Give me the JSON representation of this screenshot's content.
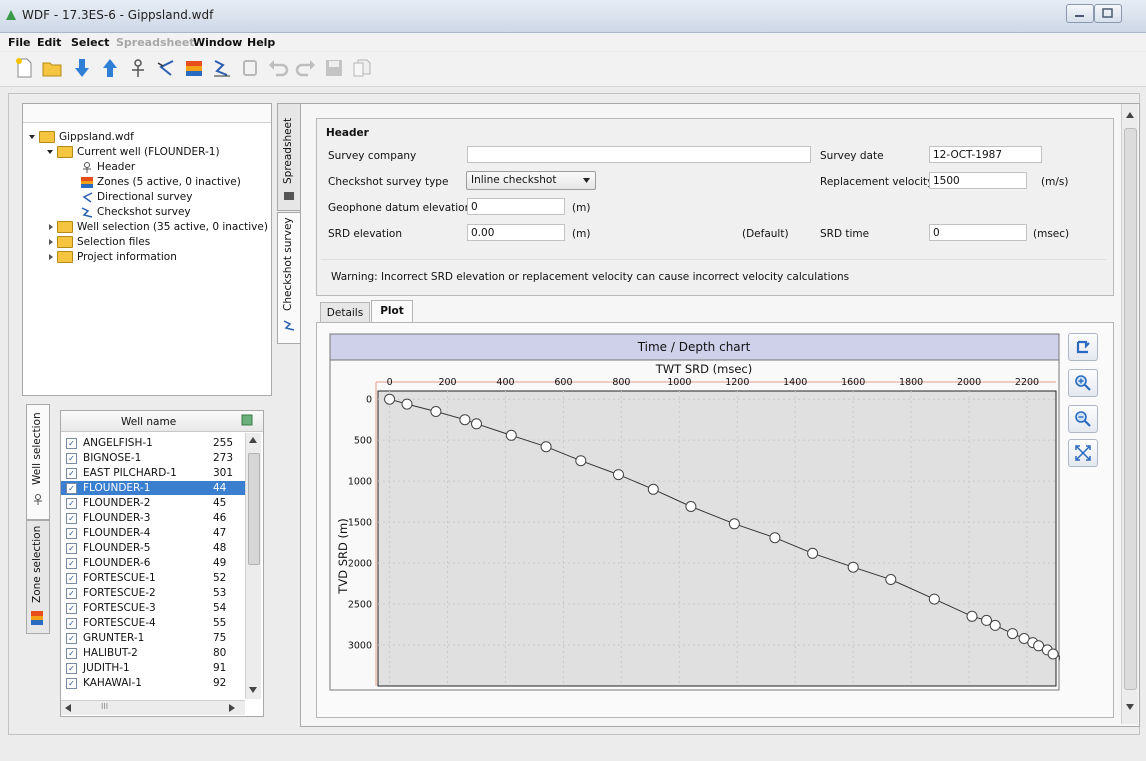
{
  "window": {
    "title": "WDF - 17.3ES-6 - Gippsland.wdf"
  },
  "menu": [
    "File",
    "Edit",
    "Select",
    "Spreadsheet",
    "Window",
    "Help"
  ],
  "menu_disabled": "Spreadsheet",
  "toolbar_icons": [
    "new-file-icon",
    "open-folder-icon",
    "import-down-icon",
    "export-up-icon",
    "well-icon",
    "directional-survey-icon",
    "zones-icon",
    "checkshot-icon",
    "disabled-icon-1",
    "undo-icon",
    "redo-icon",
    "save-icon",
    "copy-icon"
  ],
  "tree": {
    "root": "Gippsland.wdf",
    "current_well": "Current well (FLOUNDER-1)",
    "header": "Header",
    "zones": "Zones (5 active, 0 inactive)",
    "directional": "Directional survey",
    "checkshot": "Checkshot survey",
    "well_selection": "Well selection (35 active, 0 inactive)",
    "selection_files": "Selection files",
    "project_information": "Project information"
  },
  "right_tabs": {
    "spreadsheet": "Spreadsheet",
    "checkshot": "Checkshot survey"
  },
  "left_tabs": {
    "well_selection": "Well selection",
    "zone_selection": "Zone selection"
  },
  "well_list": {
    "header": "Well name",
    "rows": [
      {
        "name": "ANGELFISH-1",
        "value": "255"
      },
      {
        "name": "BIGNOSE-1",
        "value": "273"
      },
      {
        "name": "EAST PILCHARD-1",
        "value": "301"
      },
      {
        "name": "FLOUNDER-1",
        "value": "44"
      },
      {
        "name": "FLOUNDER-2",
        "value": "45"
      },
      {
        "name": "FLOUNDER-3",
        "value": "46"
      },
      {
        "name": "FLOUNDER-4",
        "value": "47"
      },
      {
        "name": "FLOUNDER-5",
        "value": "48"
      },
      {
        "name": "FLOUNDER-6",
        "value": "49"
      },
      {
        "name": "FORTESCUE-1",
        "value": "52"
      },
      {
        "name": "FORTESCUE-2",
        "value": "53"
      },
      {
        "name": "FORTESCUE-3",
        "value": "54"
      },
      {
        "name": "FORTESCUE-4",
        "value": "55"
      },
      {
        "name": "GRUNTER-1",
        "value": "75"
      },
      {
        "name": "HALIBUT-2",
        "value": "80"
      },
      {
        "name": "JUDITH-1",
        "value": "91"
      },
      {
        "name": "KAHAWAI-1",
        "value": "92"
      }
    ],
    "selected": "FLOUNDER-1",
    "hscroll_thumb": "III"
  },
  "header_section": {
    "title": "Header",
    "survey_company_label": "Survey company",
    "survey_company_value": "",
    "survey_date_label": "Survey date",
    "survey_date_value": "12-OCT-1987",
    "survey_type_label": "Checkshot survey type",
    "survey_type_value": "Inline checkshot",
    "replacement_velocity_label": "Replacement velocity",
    "replacement_velocity_value": "1500",
    "replacement_velocity_unit": "(m/s)",
    "geophone_label": "Geophone datum elevation",
    "geophone_value": "0",
    "geophone_unit": "(m)",
    "srd_elevation_label": "SRD elevation",
    "srd_elevation_value": "0.00",
    "srd_elevation_unit": "(m)",
    "default_label": "(Default)",
    "srd_time_label": "SRD time",
    "srd_time_value": "0",
    "srd_time_unit": "(msec)",
    "warning": "Warning: Incorrect SRD elevation or replacement velocity can cause incorrect velocity calculations"
  },
  "subtabs": {
    "details": "Details",
    "plot": "Plot",
    "active": "Plot"
  },
  "chart_buttons": [
    "reset-view-icon",
    "zoom-in-icon",
    "zoom-out-icon",
    "fit-icon"
  ],
  "chart_data": {
    "type": "scatter",
    "title": "Time / Depth chart",
    "xlabel": "TWT SRD (msec)",
    "ylabel": "TVD SRD (m)",
    "xlim": [
      -40,
      2300
    ],
    "ylim": [
      3500,
      -100
    ],
    "x_ticks": [
      0,
      200,
      400,
      600,
      800,
      1000,
      1200,
      1400,
      1600,
      1800,
      2000,
      2200
    ],
    "y_ticks": [
      0,
      500,
      1000,
      1500,
      2000,
      2500,
      3000
    ],
    "x_axis_position": "top",
    "grid": true,
    "series": [
      {
        "x": [
          0,
          60,
          160,
          260,
          300,
          420,
          540,
          660,
          790,
          910,
          1040,
          1190,
          1330,
          1460,
          1600,
          1730,
          1880,
          2010,
          2060,
          2090,
          2150,
          2190,
          2220,
          2240,
          2270,
          2290,
          2330,
          2360,
          2390,
          2420,
          2450
        ],
        "y": [
          0,
          60,
          150,
          250,
          300,
          440,
          580,
          750,
          920,
          1100,
          1310,
          1520,
          1690,
          1880,
          2050,
          2200,
          2440,
          2650,
          2700,
          2760,
          2860,
          2920,
          2970,
          3010,
          3060,
          3110,
          3160,
          3210,
          3260,
          3340,
          3440
        ]
      }
    ]
  }
}
